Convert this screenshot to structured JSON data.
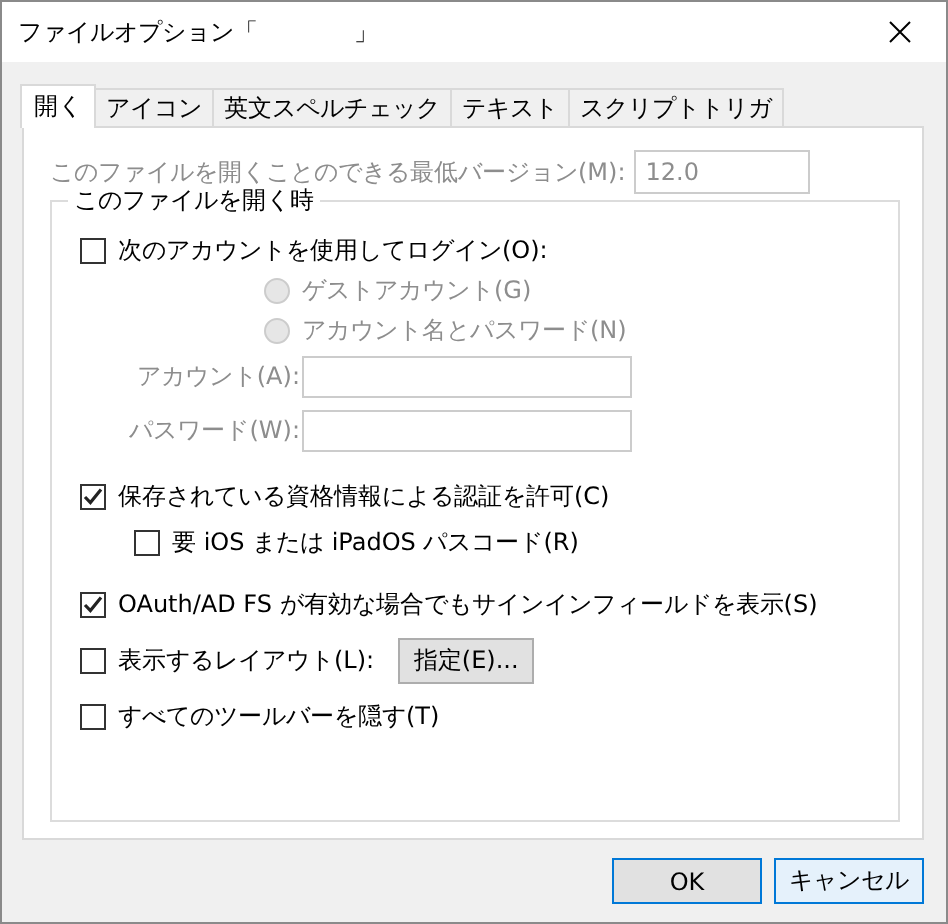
{
  "window": {
    "title": "ファイルオプション「",
    "title_end": "」"
  },
  "tabs": [
    {
      "label": "開く",
      "selected": true
    },
    {
      "label": "アイコン",
      "selected": false
    },
    {
      "label": "英文スペルチェック",
      "selected": false
    },
    {
      "label": "テキスト",
      "selected": false
    },
    {
      "label": "スクリプトトリガ",
      "selected": false
    }
  ],
  "min_version": {
    "label": "このファイルを開くことのできる最低バージョン(M):",
    "value": "12.0",
    "disabled": true
  },
  "group": {
    "title": "このファイルを開く時",
    "options": [
      {
        "kind": "checkbox",
        "label": "次のアカウントを使用してログイン(O):",
        "checked": false,
        "children": [
          {
            "kind": "radio",
            "label": "ゲストアカウント(G)",
            "selected": false,
            "disabled": true
          },
          {
            "kind": "radio",
            "label": "アカウント名とパスワード(N)",
            "selected": false,
            "disabled": true
          },
          {
            "kind": "field",
            "label": "アカウント(A):",
            "disabled": true
          },
          {
            "kind": "field",
            "label": "パスワード(W):",
            "disabled": true
          }
        ]
      },
      {
        "kind": "checkbox",
        "label": "保存されている資格情報による認証を許可(C)",
        "checked": true,
        "children": [
          {
            "kind": "checkbox",
            "label": "要 iOS または iPadOS パスコード(R)",
            "checked": false
          }
        ]
      },
      {
        "kind": "checkbox",
        "label": "OAuth/AD FS が有効な場合でもサインインフィールドを表示(S)",
        "checked": true
      },
      {
        "kind": "checkbox",
        "label": "表示するレイアウト(L):",
        "checked": false,
        "button": "指定(E)..."
      },
      {
        "kind": "checkbox",
        "label": "すべてのツールバーを隠す(T)",
        "checked": false
      }
    ]
  },
  "buttons": [
    {
      "label": "OK",
      "default": true,
      "hot": false
    },
    {
      "label": "キャンセル",
      "default": false,
      "hot": true
    }
  ]
}
